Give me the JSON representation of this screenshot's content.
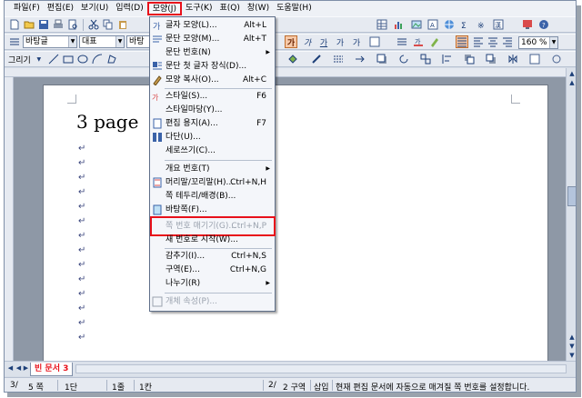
{
  "menubar": {
    "items": [
      {
        "label": "파일(F)"
      },
      {
        "label": "편집(E)"
      },
      {
        "label": "보기(U)"
      },
      {
        "label": "입력(D)"
      },
      {
        "label": "모양(J)"
      },
      {
        "label": "도구(K)"
      },
      {
        "label": "표(Q)"
      },
      {
        "label": "창(W)"
      },
      {
        "label": "도움말(H)"
      }
    ]
  },
  "toolbar2": {
    "style_combo": "바탕글",
    "font_combo": "대표",
    "font_name_combo": "바탕",
    "zoom_combo": "160 %"
  },
  "toolbar3": {
    "draw_label": "그리기"
  },
  "document": {
    "title": "3 page"
  },
  "dropdown": {
    "items": [
      {
        "label": "글자 모양(L)...",
        "shortcut": "Alt+L"
      },
      {
        "label": "문단 모양(M)...",
        "shortcut": "Alt+T"
      },
      {
        "label": "문단 번호(N)"
      },
      {
        "label": "문단 첫 글자 장식(D)..."
      },
      {
        "label": "모양 복사(O)...",
        "shortcut": "Alt+C"
      },
      {
        "label": "스타일(S)...",
        "shortcut": "F6"
      },
      {
        "label": "스타일마당(Y)..."
      },
      {
        "label": "편집 용지(A)...",
        "shortcut": "F7"
      },
      {
        "label": "다단(U)..."
      },
      {
        "label": "세로쓰기(C)..."
      },
      {
        "label": "개요 번호(T)"
      },
      {
        "label": "머리말/꼬리말(H)...",
        "shortcut": "Ctrl+N,H"
      },
      {
        "label": "쪽 테두리/배경(B)..."
      },
      {
        "label": "바탕쪽(F)..."
      },
      {
        "label": "쪽 번호 매기기(G)...",
        "shortcut": "Ctrl+N,P"
      },
      {
        "label": "새 번호로 시작(W)..."
      },
      {
        "label": "감추기(I)...",
        "shortcut": "Ctrl+N,S"
      },
      {
        "label": "구역(E)...",
        "shortcut": "Ctrl+N,G"
      },
      {
        "label": "나누기(R)"
      },
      {
        "label": "개체 속성(P)..."
      }
    ]
  },
  "doc_tab": {
    "label": "빈 문서 3"
  },
  "statusbar": {
    "page": "3/",
    "pages": "5 쪽",
    "column": "1단",
    "line": "1줄",
    "col": "1칸",
    "section": "2/",
    "section_label": "2 구역",
    "mode": "삽입",
    "message": "현재 편집 문서에 자동으로 매겨질 쪽 번호를 설정합니다."
  },
  "colors": {
    "highlight": "#e8101a",
    "menu_bg": "#f4f6fa",
    "toolbar_bg": "#e6eaf1"
  }
}
